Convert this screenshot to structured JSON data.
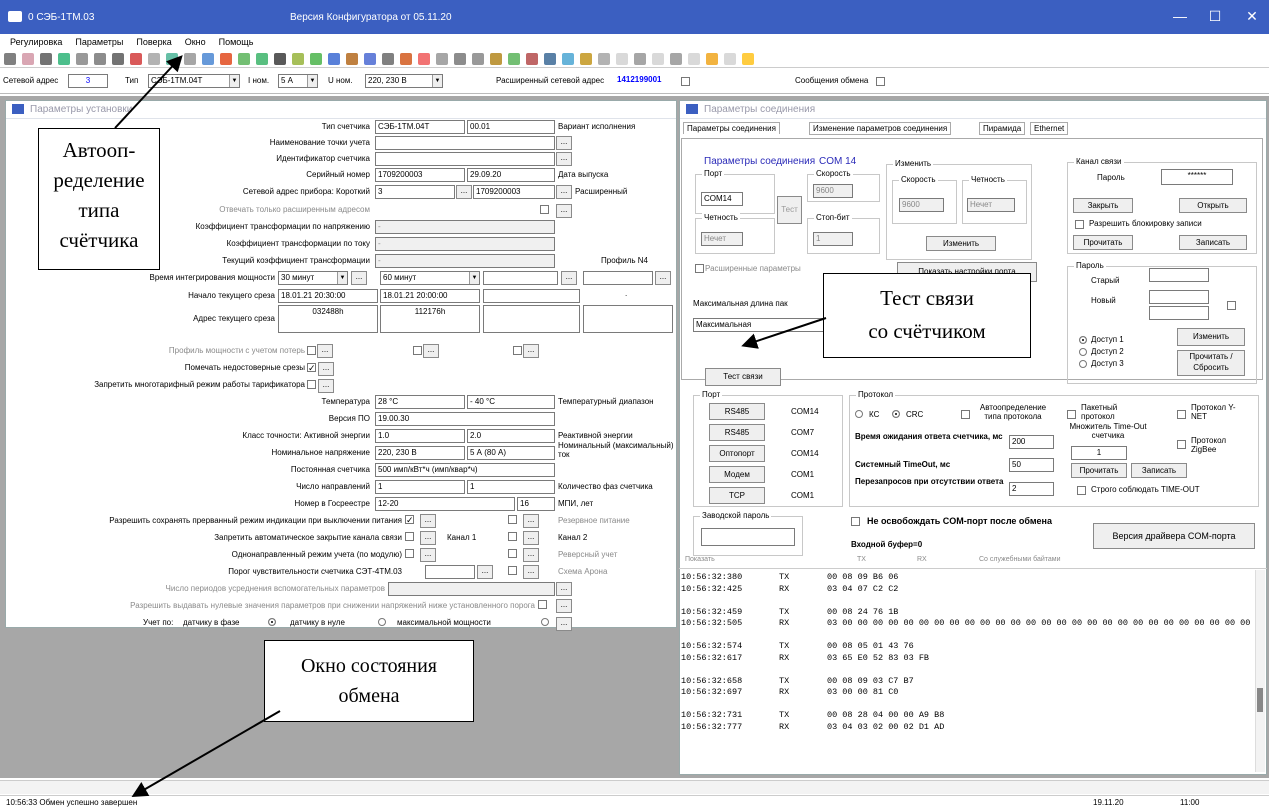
{
  "titlebar": {
    "app_title": "0 СЭБ-1ТМ.03",
    "version": "Версия Конфигуратора  от 05.11.20",
    "minimize": "—",
    "maximize": "☐",
    "close": "✕"
  },
  "menu": [
    "Регулировка",
    "Параметры",
    "Поверка",
    "Окно",
    "Помощь"
  ],
  "netbar": {
    "addr_label": "Сетевой адрес",
    "addr_value": "3",
    "type_label": "Тип",
    "type_value": "СЭБ-1ТМ.04Т",
    "inom_label": "I ном.",
    "inom_value": "5 А",
    "unom_label": "U ном.",
    "unom_value": "220, 230 В",
    "ext_label": "Расширенный сетевой адрес",
    "ext_value": "1412199001",
    "msg_label": "Сообщения обмена"
  },
  "left": {
    "title": "Параметры установки",
    "rows": {
      "type_label": "Тип счетчика",
      "type_value": "СЭБ-1ТМ.04Т",
      "type_code": "00.01",
      "variant": "Вариант исполнения",
      "point_label": "Наименование точки учета",
      "ident_label": "Идентификатор счетчика",
      "serial_label": "Серийный номер",
      "serial_value": "1709200003",
      "date_value": "29.09.20",
      "date_label": "Дата выпуска",
      "netaddr_label": "Сетевой адрес прибора: Короткий",
      "netaddr_short": "3",
      "netaddr_ext": "1709200003",
      "netaddr_ext_label": "Расширенный",
      "only_ext": "Отвечать только расширенным адресом",
      "ku_label": "Коэффициент трансформации по напряжению",
      "ku_value": "-",
      "ki_label": "Коэффициент трансформации по току",
      "ki_value": "-",
      "kt_label": "Текущий коэффициент трансформации",
      "kt_value": "-",
      "profile_label": "Профиль N4",
      "avg_label": "Время интегрирования мощности",
      "avg1": "30 минут",
      "avg2": "60 минут",
      "start_label": "Начало текущего среза",
      "start1": "18.01.21 20:30:00",
      "start2": "18.01.21 20:00:00",
      "dot": ".",
      "addr_label": "Адрес текущего среза",
      "addr1": "032488h",
      "addr2": "112176h",
      "loss_label": "Профиль мощности с учетом потерь",
      "mark_label": "Помечать недостоверные срезы",
      "forbid_label": "Запретить многотарифный режим работы тарификатора",
      "temp_label": "Температура",
      "temp1": "28 °С",
      "temp2": "- 40 °С",
      "temp_range": "Температурный диапазон",
      "ver_label": "Версия ПО",
      "ver_value": "19.00.30",
      "acc_label": "Класс точности: Активной энергии",
      "acc1": "1.0",
      "acc2": "2.0",
      "acc_react": "Реактивной энергии",
      "nom_label": "Номинальное напряжение",
      "nom1": "220, 230 В",
      "nom2": "5 А (80 А)",
      "nom_cur": "Номинальный (максимальный) ток",
      "const_label": "Постоянная счетчика",
      "const_value": "500 имп/кВт*ч (имп/квар*ч)",
      "dir_label": "Число направлений",
      "dir1": "1",
      "dir2": "1",
      "phases": "Количество фаз счетчика",
      "reg_label": "Номер в Госреестре",
      "reg1": "12-20",
      "reg2": "16",
      "mpi": "МПИ, лет",
      "save_label": "Разрешить сохранять прерванный режим индикации при выключении питания",
      "reserve": "Резервное питание",
      "autoclose_label": "Запретить автоматическое закрытие канала связи",
      "ch1": "Канал 1",
      "ch2": "Канал 2",
      "uni_label": "Однонаправленный режим учета (по модулю)",
      "rev": "Реверсный учет",
      "thr_label": "Порог чувствительности счетчика СЭТ-4ТМ.03",
      "arona": "Схема Арона",
      "periods_label": "Число периодов усреднения вспомогательных параметров",
      "zero_label": "Разрешить выдавать нулевые значения параметров при снижении напряжений ниже установленного порога",
      "acct_label": "Учет по:",
      "acct1": "датчику в фазе",
      "acct2": "датчику в нуле",
      "acct3": "максимальной мощности",
      "ellipsis": "..."
    }
  },
  "right": {
    "title": "Параметры соединения",
    "tabs": [
      "Параметры соединения",
      "Изменение параметров соединения",
      "Пирамида",
      "Ethernet"
    ],
    "conn_title": "Параметры соединения",
    "conn_port": "COM 14",
    "port_grp": "Порт",
    "port_value": "COM14",
    "parity_grp": "Четность",
    "parity_value": "Нечет",
    "speed_grp": "Скорость",
    "speed_value": "9600",
    "stop_grp": "Стоп-бит",
    "stop_value": "1",
    "test_small": "Тест",
    "change_grp": "Изменить",
    "ch_speed": "Скорость",
    "ch_speed_v": "9600",
    "ch_parity": "Четность",
    "ch_parity_v": "Нечет",
    "change_btn": "Изменить",
    "ext_params": "Расширенные параметры",
    "show_port": "Показать настройки порта",
    "maxlen": "Максимальная длина пак",
    "maxlen_v": "Максимальная",
    "channel_grp": "Канал связи",
    "pass_label": "Пароль",
    "pass_value": "******",
    "close_btn": "Закрыть",
    "open_btn": "Открыть",
    "allow_lock": "Разрешить блокировку записи",
    "read_btn": "Прочитать",
    "write_btn": "Записать",
    "pwd_grp": "Пароль",
    "old": "Старый",
    "new": "Новый",
    "access1": "Доступ 1",
    "access2": "Доступ 2",
    "access3": "Доступ 3",
    "change2": "Изменить",
    "readreset": "Прочитать / Сбросить",
    "test_btn": "Тест связи",
    "port2_grp": "Порт",
    "ports": [
      {
        "btn": "RS485",
        "com": "COM14"
      },
      {
        "btn": "RS485",
        "com": "COM7"
      },
      {
        "btn": "Оптопорт",
        "com": "COM14"
      },
      {
        "btn": "Модем",
        "com": "COM1"
      },
      {
        "btn": "TCP",
        "com": "COM1"
      }
    ],
    "proto_grp": "Протокол",
    "kc": "КС",
    "crc": "CRC",
    "autodet": "Автоопределение типа протокола",
    "packet": "Пакетный протокол",
    "ynet": "Протокол Y-NET",
    "wait_label": "Время ожидания ответа счетчика, мс",
    "wait_v": "200",
    "mult": "Множитель Time-Out счетчика",
    "mult_v": "1",
    "zigbee": "Протокол ZigBee",
    "sys_label": "Системный TimeOut, мс",
    "sys_v": "50",
    "req_label": "Перезапросов при отсутствии ответа",
    "req_v": "2",
    "read2": "Прочитать",
    "write2": "Записать",
    "strict": "Строго соблюдать TIME-OUT",
    "factory_grp": "Заводской пароль",
    "noreleae": "Не освобождать COM-порт после обмена",
    "buffer": "Входной буфер=0",
    "driver_btn": "Версия драйвера COM-порта",
    "log_hdr": [
      "Показать",
      "TX",
      "RX",
      "Со служебными байтами"
    ],
    "log": [
      [
        "10:56:32:380",
        "TX",
        "00 08 09 B6 06"
      ],
      [
        "10:56:32:425",
        "RX",
        "03 04 07 C2 C2"
      ],
      [
        "",
        "",
        " "
      ],
      [
        "10:56:32:459",
        "TX",
        "00 08 24 76 1B"
      ],
      [
        "10:56:32:505",
        "RX",
        "03 00 00 00 00 00 00 00 00 00 00 00 00 00 00 00 00 00 00 00 00 00 00 00 00 00 00 00 00"
      ],
      [
        "",
        "",
        " "
      ],
      [
        "10:56:32:574",
        "TX",
        "00 08 05 01 43 76"
      ],
      [
        "10:56:32:617",
        "RX",
        "03 65 E0 52 83 03 FB"
      ],
      [
        "",
        "",
        " "
      ],
      [
        "10:56:32:658",
        "TX",
        "00 08 09 03 C7 B7"
      ],
      [
        "10:56:32:697",
        "RX",
        "03 00 00 81 C0"
      ],
      [
        "",
        "",
        " "
      ],
      [
        "10:56:32:731",
        "TX",
        "00 08 28 04 00 00 A9 B8"
      ],
      [
        "10:56:32:777",
        "RX",
        "03 04 03 02 00 02 D1 AD"
      ]
    ]
  },
  "annotations": {
    "auto": "Автооп-\nределение\nтипа\nсчётчика",
    "test": "Тест связи\nсо счётчиком",
    "state": "Окно состояния\nобмена"
  },
  "status": {
    "msg": "10:56:33  Обмен успешно завершен",
    "date": "19.11.20",
    "time": "11:00"
  }
}
